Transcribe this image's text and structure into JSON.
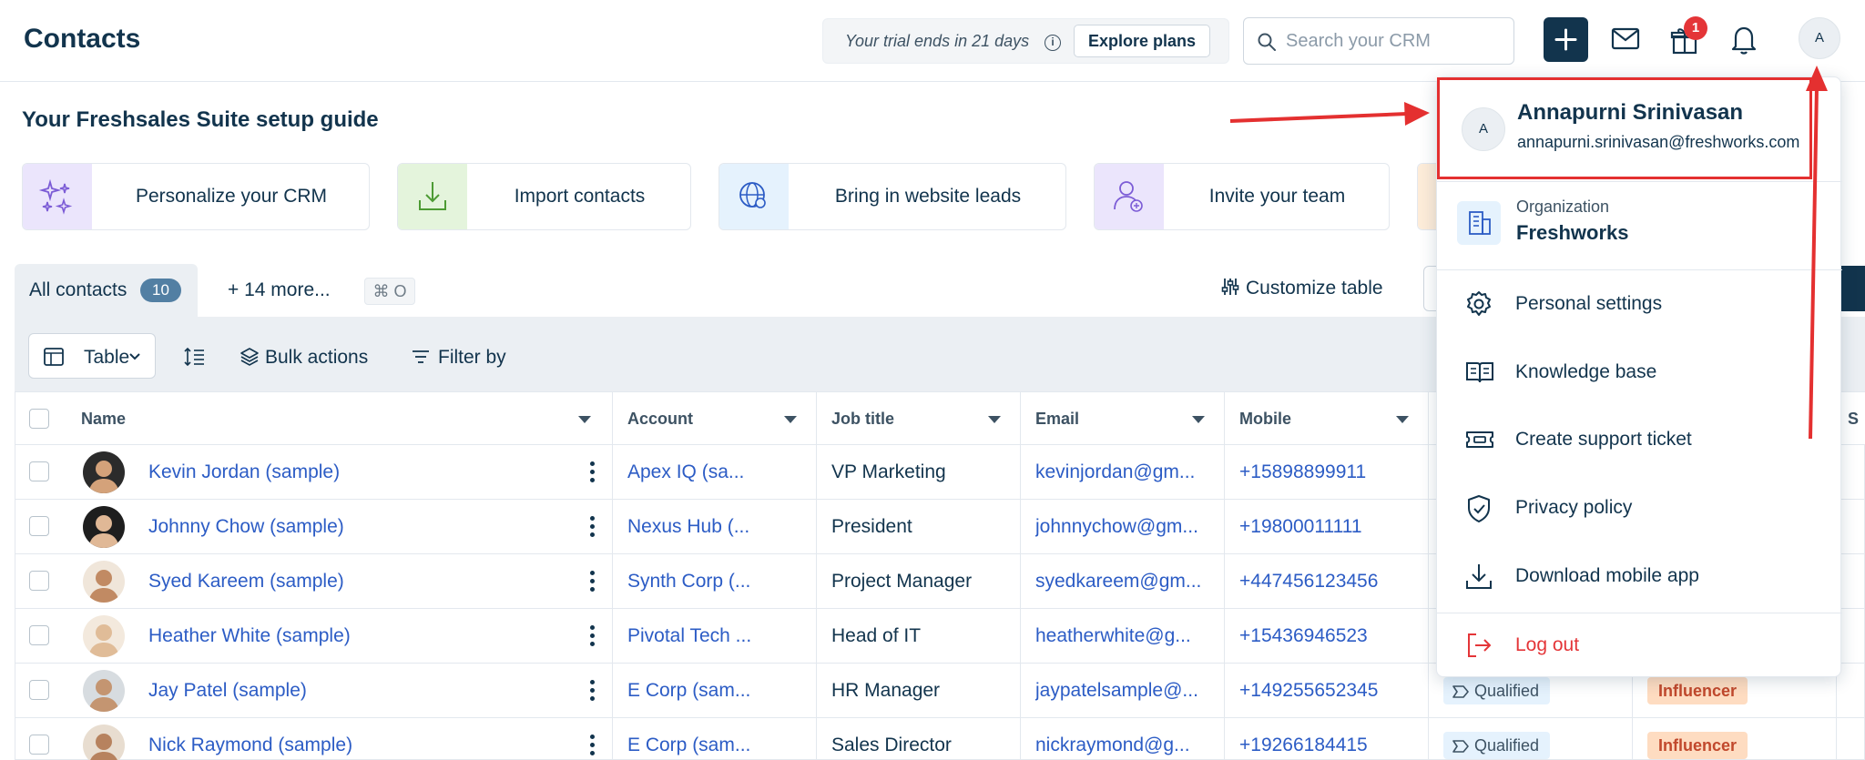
{
  "header": {
    "title": "Contacts",
    "trial_text": "Your trial ends in 21 days",
    "info_glyph": "i",
    "explore_label": "Explore plans",
    "search_placeholder": "Search your CRM",
    "notification_count": "1",
    "avatar_initial": "A"
  },
  "guide": {
    "title": "Your Freshsales Suite setup guide",
    "cards": [
      {
        "label": "Personalize your CRM",
        "icon": "sparkles-icon",
        "color": "#ebe5fc"
      },
      {
        "label": "Import contacts",
        "icon": "download-tray-icon",
        "color": "#e4f4dc"
      },
      {
        "label": "Bring in website leads",
        "icon": "globe-icon",
        "color": "#e5f2fd"
      },
      {
        "label": "Invite your team",
        "icon": "add-user-icon",
        "color": "#ebe5fc"
      },
      {
        "label": "",
        "icon": "partial-card-icon",
        "color": "#fdecd9"
      }
    ]
  },
  "tabs": {
    "active_label": "All contacts",
    "active_count": "10",
    "more_label": "+ 14 more...",
    "shortcut": "⌘ O",
    "customize_label": "Customize table"
  },
  "toolbar": {
    "view_label": "Table",
    "bulk_label": "Bulk actions",
    "filter_label": "Filter by"
  },
  "table": {
    "columns": [
      "Name",
      "Account",
      "Job title",
      "Email",
      "Mobile",
      "",
      "",
      "S"
    ],
    "rows": [
      {
        "name": "Kevin Jordan (sample)",
        "account": "Apex IQ (sa...",
        "job": "VP Marketing",
        "email": "kevinjordan@gm...",
        "mobile": "+15898899911",
        "status": "",
        "role": ""
      },
      {
        "name": "Johnny Chow (sample)",
        "account": "Nexus Hub (...",
        "job": "President",
        "email": "johnnychow@gm...",
        "mobile": "+19800011111",
        "status": "",
        "role": ""
      },
      {
        "name": "Syed Kareem (sample)",
        "account": "Synth Corp (...",
        "job": "Project Manager",
        "email": "syedkareem@gm...",
        "mobile": "+447456123456",
        "status": "",
        "role": ""
      },
      {
        "name": "Heather White (sample)",
        "account": "Pivotal Tech ...",
        "job": "Head of IT",
        "email": "heatherwhite@g...",
        "mobile": "+15436946523",
        "status": "",
        "role": ""
      },
      {
        "name": "Jay Patel (sample)",
        "account": "E Corp (sam...",
        "job": "HR Manager",
        "email": "jaypatelsample@...",
        "mobile": "+149255652345",
        "status": "Qualified",
        "role": "Influencer"
      },
      {
        "name": "Nick Raymond (sample)",
        "account": "E Corp (sam...",
        "job": "Sales Director",
        "email": "nickraymond@g...",
        "mobile": "+19266184415",
        "status": "Qualified",
        "role": "Influencer"
      }
    ]
  },
  "menu": {
    "avatar_initial": "A",
    "user_name": "Annapurni Srinivasan",
    "user_email": "annapurni.srinivasan@freshworks.com",
    "org_label": "Organization",
    "org_name": "Freshworks",
    "items": [
      {
        "label": "Personal settings",
        "icon": "gear-icon"
      },
      {
        "label": "Knowledge base",
        "icon": "book-icon"
      },
      {
        "label": "Create support ticket",
        "icon": "ticket-icon"
      },
      {
        "label": "Privacy policy",
        "icon": "shield-check-icon"
      },
      {
        "label": "Download mobile app",
        "icon": "download-icon"
      },
      {
        "label": "Log out",
        "icon": "logout-icon"
      }
    ]
  },
  "colors": {
    "brand_dark": "#12344d",
    "link": "#2c5cc5",
    "danger": "#e43538",
    "annotation_red": "#e43030"
  }
}
